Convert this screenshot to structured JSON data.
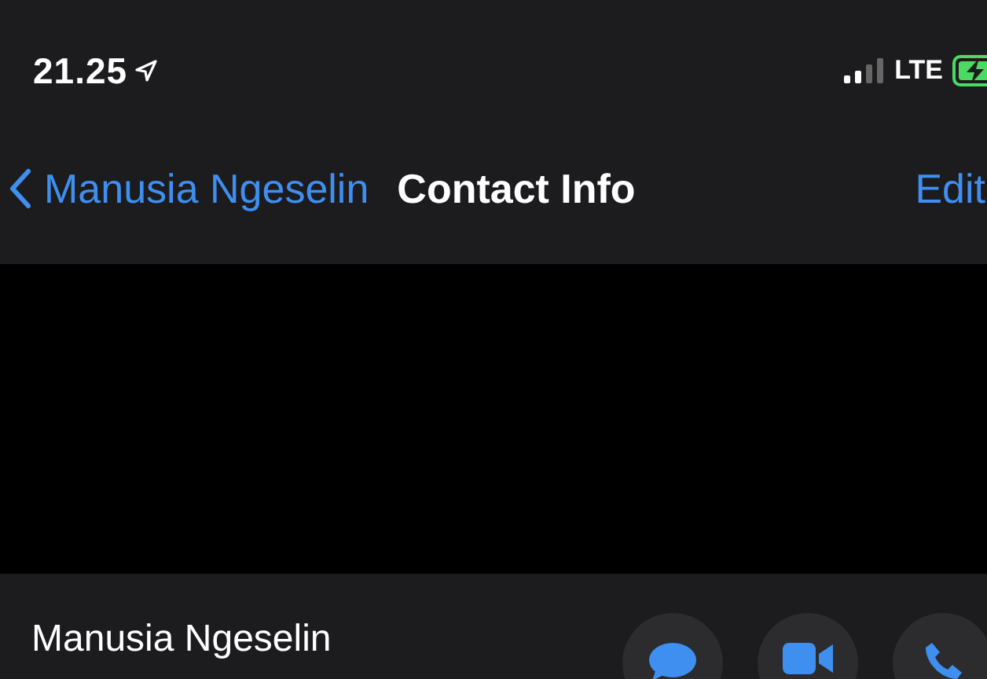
{
  "status_bar": {
    "time": "21.25",
    "network": "LTE"
  },
  "nav_bar": {
    "back_label": "Manusia Ngeselin",
    "title": "Contact Info",
    "action": "Edit"
  },
  "contact": {
    "name": "Manusia Ngeselin",
    "actions": [
      {
        "kind": "message"
      },
      {
        "kind": "video"
      },
      {
        "kind": "call"
      }
    ]
  }
}
